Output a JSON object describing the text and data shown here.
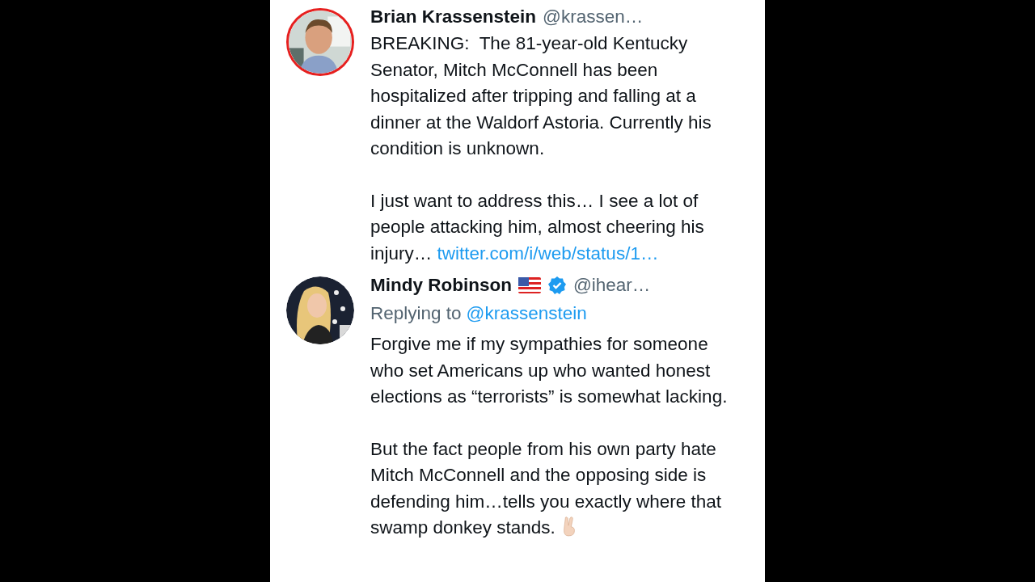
{
  "tweets": [
    {
      "author": "Brian Krassenstein",
      "handle": "@krassen…",
      "circled": true,
      "paragraphs": [
        {
          "text": "BREAKING:  The 81-year-old Kentucky Senator, Mitch McConnell has been hospitalized after tripping and falling at a dinner at the Waldorf Astoria. Currently his condition is unknown."
        },
        {
          "text": "I just want to address this… I see a lot of people attacking him, almost cheering his injury…",
          "link": "twitter.com/i/web/status/1…"
        }
      ]
    },
    {
      "author": "Mindy Robinson",
      "handle": "@ihear…",
      "circled": false,
      "verified": true,
      "flag": true,
      "reply_to": {
        "label": "Replying to",
        "handle": "@krassenstein"
      },
      "paragraphs": [
        {
          "text": "Forgive me if my sympathies for someone who set Americans up who wanted honest elections as “terrorists” is somewhat lacking."
        },
        {
          "text": "But the fact people from his own party hate Mitch McConnell and the opposing side is defending him…tells you exactly where that swamp donkey stands.",
          "emoji": true
        }
      ]
    }
  ]
}
